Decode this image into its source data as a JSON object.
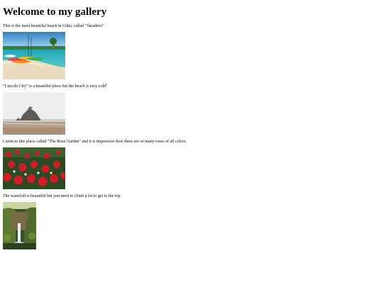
{
  "page": {
    "title": "Welcome to my gallery"
  },
  "gallery": [
    {
      "caption": "This is the most beautiful beach in Cuba, called \"Varadero\"",
      "image": "beach-with-kayaks-photo"
    },
    {
      "caption": "\"Lincoln City\" is a beautiful place but the beach is very cold\"",
      "image": "rock-on-beach-photo"
    },
    {
      "caption": "I went to this place called \"The Rose Garden\" and it is impressive how there are so many roses of all colors.",
      "image": "red-roses-photo"
    },
    {
      "caption": "The waterfall is beautiful but you need to climb a lot to get to the top.",
      "image": "waterfall-photo"
    }
  ]
}
